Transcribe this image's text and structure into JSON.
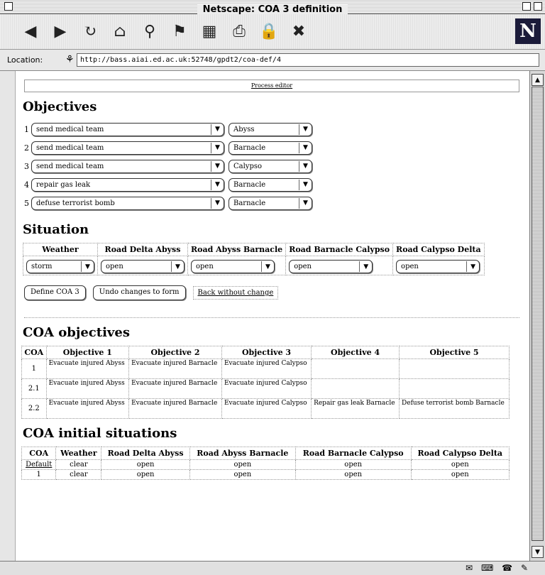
{
  "window": {
    "title": "Netscape: COA 3 definition"
  },
  "toolbar": {
    "buttons": [
      {
        "name": "back-icon",
        "glyph": "◀"
      },
      {
        "name": "forward-icon",
        "glyph": "▶"
      },
      {
        "name": "reload-icon",
        "glyph": "↻"
      },
      {
        "name": "home-icon",
        "glyph": "⌂"
      },
      {
        "name": "search-icon",
        "glyph": "⚲"
      },
      {
        "name": "guide-icon",
        "glyph": "⚑"
      },
      {
        "name": "images-icon",
        "glyph": "▦"
      },
      {
        "name": "print-icon",
        "glyph": "⎙"
      },
      {
        "name": "security-icon",
        "glyph": "🔒"
      },
      {
        "name": "stop-icon",
        "glyph": "✖"
      }
    ],
    "logo": "N"
  },
  "location": {
    "label": "Location:",
    "url": "http://bass.aiai.ed.ac.uk:52748/gpdt2/coa-def/4"
  },
  "page": {
    "process_editor_link": "Process editor",
    "objectives_heading": "Objectives",
    "objectives": [
      {
        "num": "1",
        "objective": "send medical team",
        "location": "Abyss"
      },
      {
        "num": "2",
        "objective": "send medical team",
        "location": "Barnacle"
      },
      {
        "num": "3",
        "objective": "send medical team",
        "location": "Calypso"
      },
      {
        "num": "4",
        "objective": "repair gas leak",
        "location": "Barnacle"
      },
      {
        "num": "5",
        "objective": "defuse terrorist bomb",
        "location": "Barnacle"
      }
    ],
    "situation_heading": "Situation",
    "situation": {
      "headers": [
        "Weather",
        "Road Delta Abyss",
        "Road Abyss Barnacle",
        "Road Barnacle Calypso",
        "Road Calypso Delta"
      ],
      "values": [
        "storm",
        "open",
        "open",
        "open",
        "open"
      ]
    },
    "buttons": {
      "define": "Define COA 3",
      "undo": "Undo changes to form",
      "back": "Back without change"
    },
    "coa_objectives_heading": "COA objectives",
    "coa_objectives": {
      "headers": [
        "COA",
        "Objective 1",
        "Objective 2",
        "Objective 3",
        "Objective 4",
        "Objective 5"
      ],
      "rows": [
        [
          "1",
          "Evacuate injured Abyss",
          "Evacuate injured Barnacle",
          "Evacuate injured Calypso",
          "",
          ""
        ],
        [
          "2.1",
          "Evacuate injured Abyss",
          "Evacuate injured Barnacle",
          "Evacuate injured Calypso",
          "",
          ""
        ],
        [
          "2.2",
          "Evacuate injured Abyss",
          "Evacuate injured Barnacle",
          "Evacuate injured Calypso",
          "Repair gas leak Barnacle",
          "Defuse terrorist bomb Barnacle"
        ]
      ]
    },
    "coa_initial_heading": "COA initial situations",
    "coa_initial": {
      "headers": [
        "COA",
        "Weather",
        "Road Delta Abyss",
        "Road Abyss Barnacle",
        "Road Barnacle Calypso",
        "Road Calypso Delta"
      ],
      "rows": [
        [
          "Default",
          "clear",
          "open",
          "open",
          "open",
          "open"
        ],
        [
          "1",
          "clear",
          "open",
          "open",
          "open",
          "open"
        ]
      ]
    }
  }
}
